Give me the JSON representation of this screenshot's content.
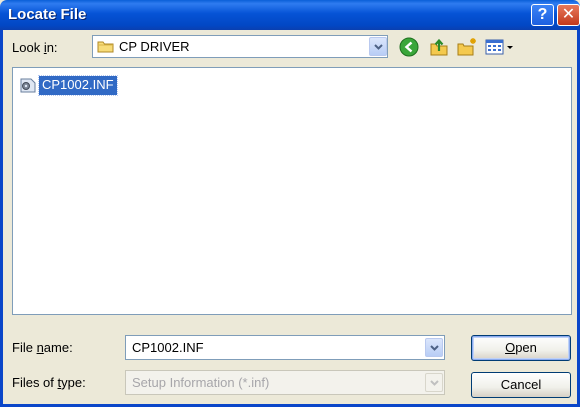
{
  "window": {
    "title": "Locate File"
  },
  "lookin": {
    "label_pre": "Look ",
    "label_u": "i",
    "label_post": "n:",
    "value": "CP DRIVER"
  },
  "files": [
    {
      "name": "CP1002.INF"
    }
  ],
  "filename": {
    "label_pre": "File ",
    "label_u": "n",
    "label_post": "ame:",
    "value": "CP1002.INF"
  },
  "filetype": {
    "label_pre": "Files of ",
    "label_u": "t",
    "label_post": "ype:",
    "value": "Setup Information (*.inf)"
  },
  "buttons": {
    "open_u": "O",
    "open_rest": "pen",
    "cancel": "Cancel"
  },
  "icons": {
    "help": "question-mark-icon",
    "close": "close-x-icon",
    "folder": "folder-icon",
    "back": "back-arrow-icon",
    "up": "up-one-level-icon",
    "new_folder": "new-folder-icon",
    "view": "view-menu-icon",
    "file": "setup-information-file-icon"
  },
  "colors": {
    "titlebar": "#0653d6",
    "selection": "#316ac5",
    "face": "#ece9d8"
  }
}
